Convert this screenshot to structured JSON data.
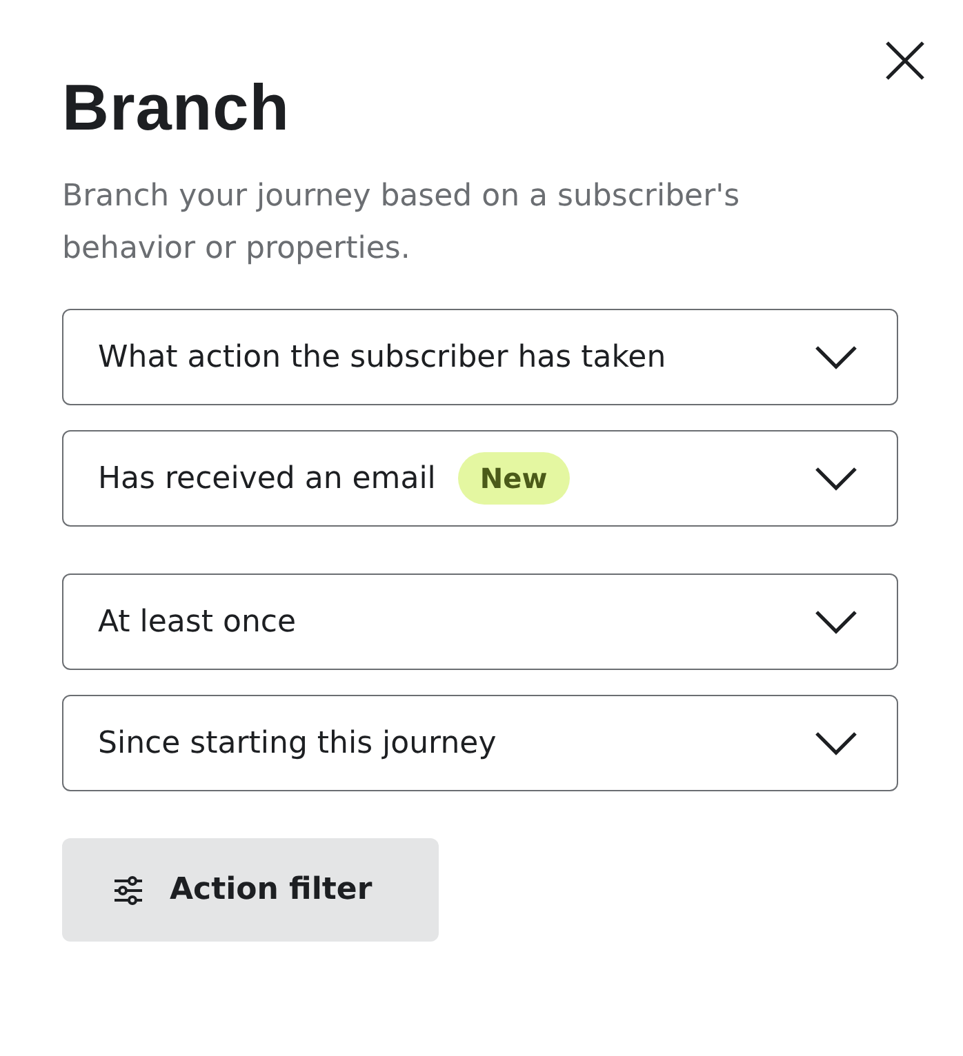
{
  "panel": {
    "title": "Branch",
    "description": "Branch your journey based on a subscriber's behavior or properties."
  },
  "dropdown_groups": [
    [
      {
        "value": "What action the subscriber has taken"
      },
      {
        "value": "Has received an email",
        "badge": "New"
      }
    ],
    [
      {
        "value": "At least once"
      },
      {
        "value": "Since starting this journey"
      }
    ]
  ],
  "button": {
    "label": "Action filter"
  }
}
